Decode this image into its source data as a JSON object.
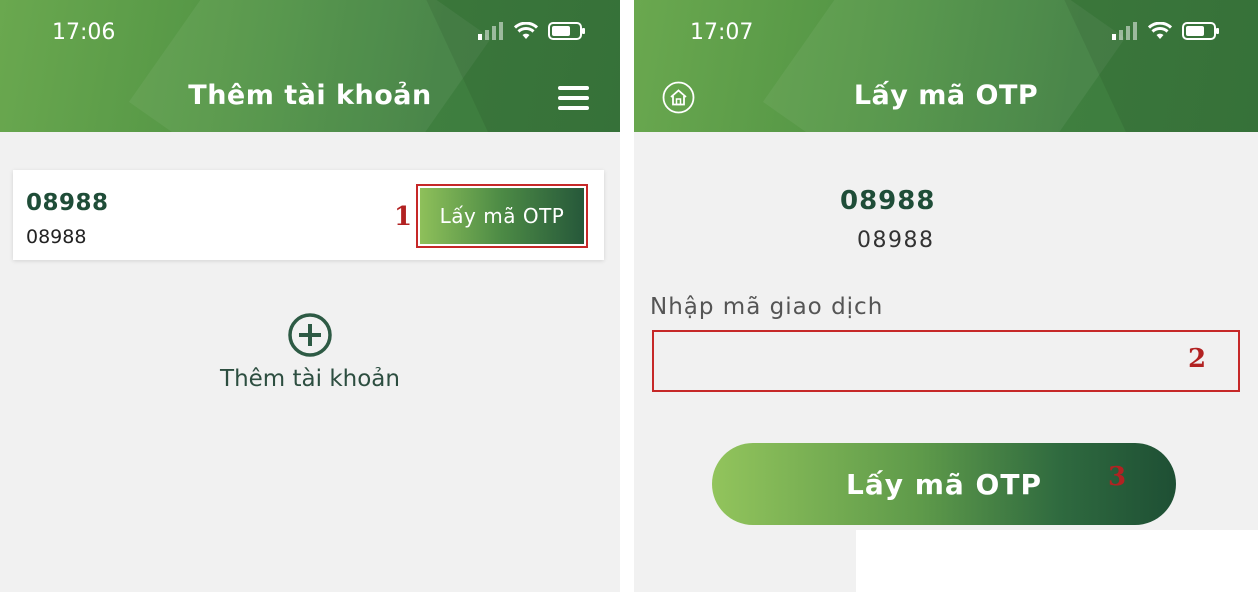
{
  "left_screen": {
    "status": {
      "time": "17:06"
    },
    "header": {
      "title": "Thêm tài khoản",
      "menu_icon": "hamburger-menu-icon"
    },
    "account": {
      "name": "08988",
      "number": "08988",
      "otp_button_label": "Lấy mã OTP"
    },
    "marker_1": "1",
    "add_account": {
      "icon": "plus-circle-icon",
      "label": "Thêm tài khoản"
    }
  },
  "right_screen": {
    "status": {
      "time": "17:07"
    },
    "header": {
      "title": "Lấy mã OTP",
      "home_icon": "home-icon"
    },
    "account": {
      "name": "08988",
      "number": "08988"
    },
    "transaction_code": {
      "label": "Nhập mã giao dịch",
      "value": "",
      "placeholder": ""
    },
    "marker_2": "2",
    "otp_button_label": "Lấy mã OTP",
    "marker_3": "3"
  },
  "colors": {
    "header_green": "#4e9143",
    "dark_green_text": "#1f4d38",
    "annotation_red": "#c62828",
    "background": "#f1f1f1"
  }
}
